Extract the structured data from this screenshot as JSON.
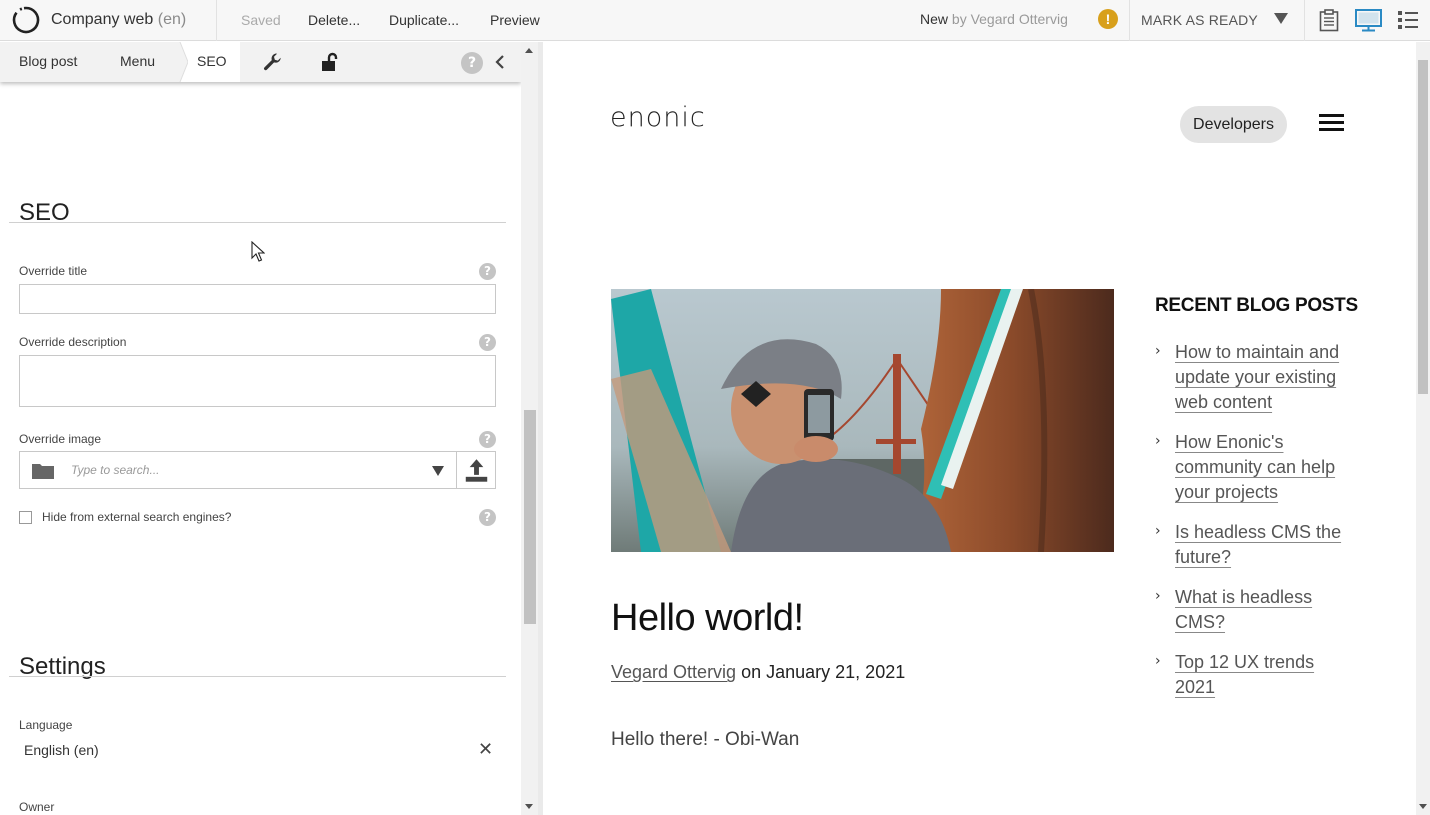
{
  "toolbar": {
    "app_title": "Company web",
    "app_lang": "(en)",
    "saved_label": "Saved",
    "delete_label": "Delete...",
    "duplicate_label": "Duplicate...",
    "preview_label": "Preview",
    "status_label": "New",
    "status_by": "by Vegard Ottervig",
    "warning_glyph": "!",
    "mark_ready_label": "MARK AS READY",
    "icons": [
      "logo-icon",
      "warning-icon",
      "dropdown-caret-icon",
      "clipboard-icon",
      "desktop-icon",
      "list-icon"
    ],
    "accent_color": "#2a8ac4",
    "warning_color": "#d8a01c"
  },
  "tabs": {
    "items": [
      "Blog post",
      "Menu",
      "SEO"
    ],
    "active": "SEO",
    "help_glyph": "?"
  },
  "seo": {
    "title": "SEO",
    "override_title_label": "Override title",
    "override_title_value": "",
    "override_description_label": "Override description",
    "override_description_value": "",
    "override_image_label": "Override image",
    "image_search_placeholder": "Type to search...",
    "hide_label": "Hide from external search engines?",
    "hide_checked": false,
    "help_glyph": "?"
  },
  "settings": {
    "title": "Settings",
    "language_label": "Language",
    "language_value": "English (en)",
    "remove_glyph": "✕",
    "owner_label": "Owner"
  },
  "preview": {
    "brand": "enonic",
    "developers_label": "Developers",
    "post_title": "Hello world!",
    "author": "Vegard Ottervig",
    "date_text": "on January 21, 2021",
    "excerpt": "Hello there! - Obi-Wan",
    "recent_title": "RECENT BLOG POSTS",
    "recent_chevron": "›",
    "recent_posts": [
      "How to maintain and update your existing web content",
      "How Enonic's community can help your projects",
      "Is headless CMS the future?",
      "What is headless CMS?",
      "Top 12 UX trends 2021"
    ]
  }
}
